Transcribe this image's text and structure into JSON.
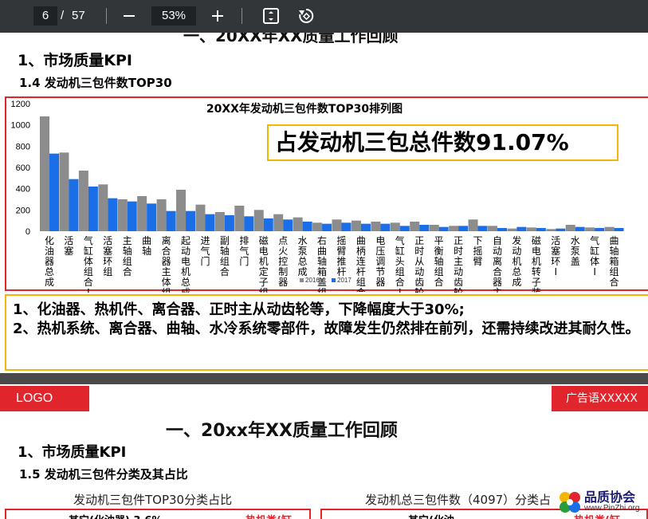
{
  "toolbar": {
    "current_page": "6",
    "separator": "/",
    "total_pages": "57",
    "zoom": "53%"
  },
  "page1": {
    "cut_title": "一、20XX年XX质量工作回顾",
    "heading1": "1、市场质量KPI",
    "heading2": "1.4  发动机三包件数TOP30",
    "callout": "占发动机三包总件数91.07%",
    "notes": [
      "1、化油器、热机件、离合器、正时主从动齿轮等，下降幅度大于30%;",
      "2、热机系统、离合器、曲轴、水冷系统零部件，故障发生仍然排在前列，还需持续改进其耐久性。"
    ]
  },
  "chart_data": {
    "type": "bar",
    "title": "20XX年发动机三包件数TOP30排列图",
    "ylim": [
      0,
      1200
    ],
    "yticks": [
      0,
      200,
      400,
      600,
      800,
      1000,
      1200
    ],
    "categories": [
      "化油器总成",
      "活塞",
      "气缸体组合I",
      "活塞环组",
      "主轴组合",
      "曲轴",
      "离合器主体组合",
      "起动电机总成",
      "进气门",
      "副轴组合",
      "排气门",
      "磁电机定子组合",
      "点火控制器",
      "水泵总成",
      "右曲轴箱盖组合",
      "摇臂推杆",
      "曲柄连杆组合",
      "电压调节器",
      "气缸头组合I",
      "正时从动齿轮组合",
      "平衡轴组合",
      "正时主动齿轮",
      "下摇臂",
      "自动离合器主体…",
      "发动机总成",
      "磁电机转子装配…",
      "活塞环I",
      "水泵盖",
      "气缸体I",
      "曲轴箱组合"
    ],
    "series": [
      {
        "name": "2016",
        "color": "#8c8c8c",
        "values": [
          1080,
          740,
          570,
          440,
          300,
          330,
          300,
          390,
          250,
          180,
          240,
          200,
          160,
          130,
          80,
          110,
          100,
          90,
          80,
          90,
          60,
          50,
          110,
          50,
          25,
          35,
          20,
          60,
          35,
          40
        ]
      },
      {
        "name": "2017",
        "color": "#1a6ee8",
        "values": [
          730,
          490,
          420,
          310,
          280,
          260,
          190,
          190,
          160,
          150,
          140,
          120,
          110,
          90,
          70,
          80,
          70,
          70,
          50,
          60,
          40,
          50,
          50,
          30,
          40,
          30,
          25,
          40,
          30,
          30
        ]
      }
    ],
    "legend": "bottom"
  },
  "footer": {
    "logo": "LOGO",
    "slogan": "广告语XXXXX"
  },
  "page2": {
    "title": "一、20xx年XX质量工作回顾",
    "heading1": "1、市场质量KPI",
    "heading2": "1.5  发动机三包件分类及其占比",
    "sub_left": "发动机三包件TOP30分类占比",
    "sub_right": "发动机总三包件数（4097）分类占",
    "frag_left_a": "其它(化油器) 3.6%",
    "frag_left_b": "热机类(缸",
    "frag_right_a": "其它(化油",
    "frag_right_b": "热机类(缸"
  },
  "watermark": {
    "text": "品质协会",
    "url": "www.PinZhi.org"
  }
}
